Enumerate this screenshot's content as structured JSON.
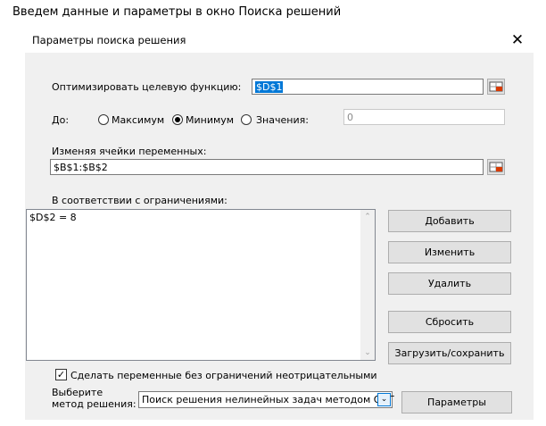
{
  "caption": "Введем данные и параметры в окно Поиска решений",
  "dialog": {
    "title": "Параметры поиска решения",
    "close_glyph": "✕",
    "objective": {
      "label": "Оптимизировать целевую функцию:",
      "value": "$D$1"
    },
    "to": {
      "label": "До:",
      "options": [
        "Максимум",
        "Минимум",
        "Значения:"
      ],
      "selected": "Минимум",
      "value_field": "0"
    },
    "variables": {
      "label": "Изменяя ячейки переменных:",
      "value": "$B$1:$B$2"
    },
    "constraints": {
      "label": "В соответствии с ограничениями:",
      "items": [
        "$D$2 = 8"
      ]
    },
    "buttons": {
      "add": "Добавить",
      "change": "Изменить",
      "delete": "Удалить",
      "reset": "Сбросить",
      "load_save": "Загрузить/сохранить",
      "params": "Параметры"
    },
    "nonneg": {
      "label": "Сделать переменные без ограничений неотрицательными",
      "checked": true
    },
    "method": {
      "label_line1": "Выберите",
      "label_line2": "метод решения:",
      "value": "Поиск решения нелинейных задач методом ОПГ"
    }
  }
}
